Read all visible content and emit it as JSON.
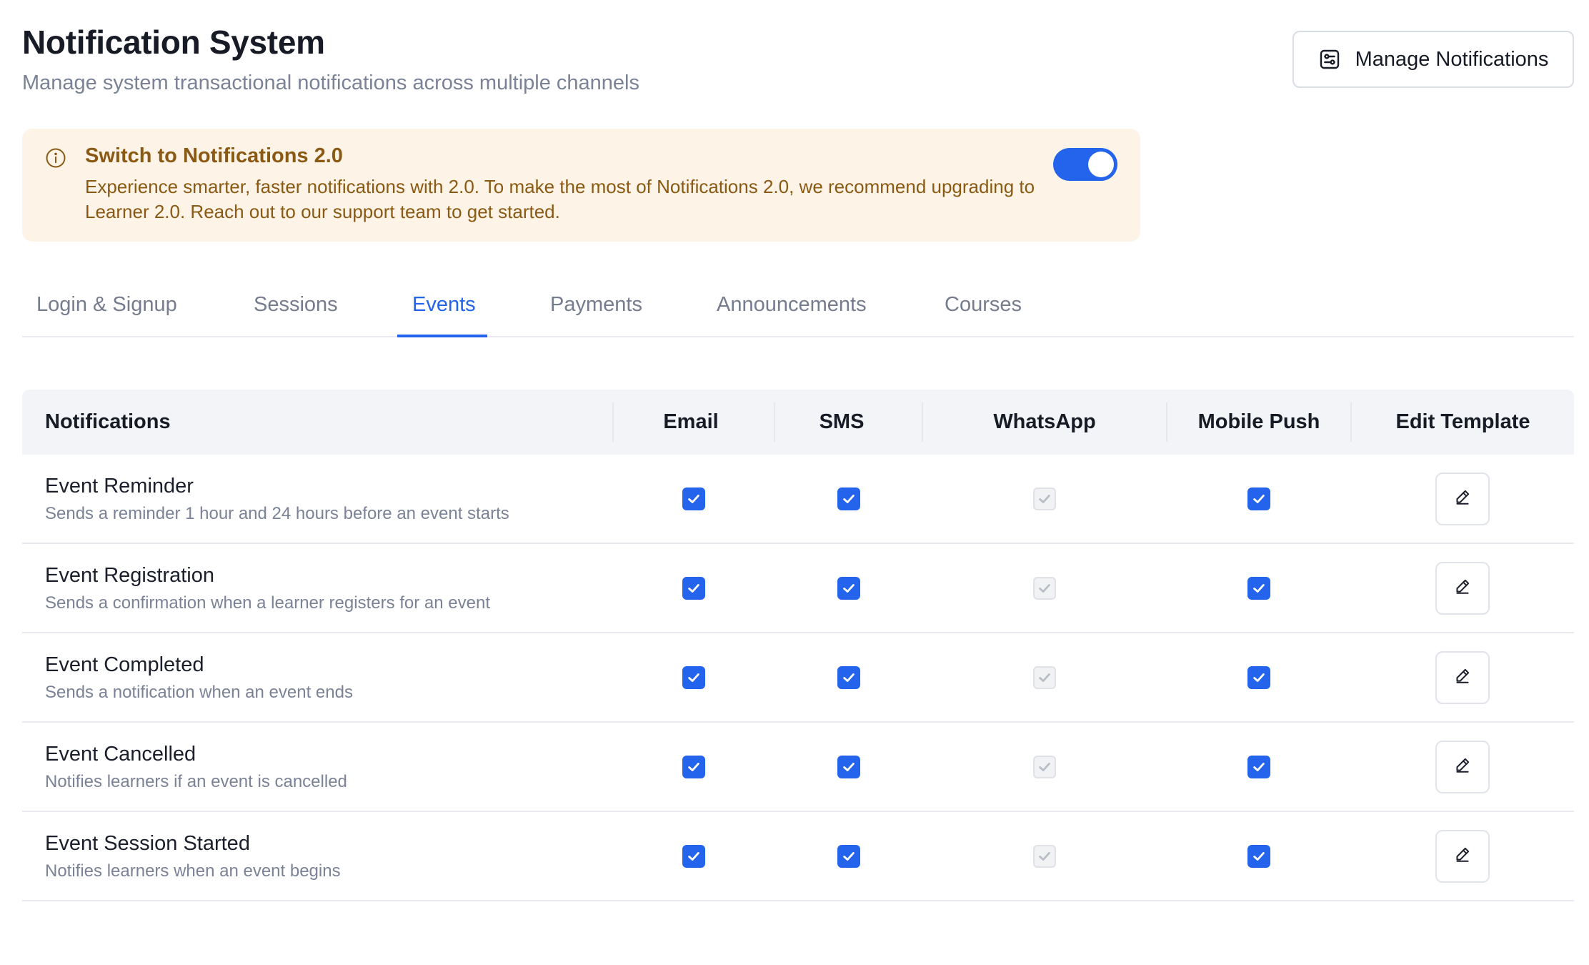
{
  "header": {
    "title": "Notification System",
    "subtitle": "Manage system transactional notifications across multiple channels",
    "manage_button_label": "Manage Notifications",
    "manage_button_icon": "settings-sliders-icon"
  },
  "banner": {
    "icon": "info-icon",
    "title": "Switch to Notifications 2.0",
    "text": "Experience smarter, faster notifications with 2.0. To make the most of Notifications 2.0, we recommend upgrading to Learner 2.0. Reach out to our support team to get started.",
    "toggle_on": true,
    "background_color": "#fdf3e7",
    "text_color": "#8a5a14"
  },
  "tabs": [
    {
      "label": "Login & Signup",
      "active": false
    },
    {
      "label": "Sessions",
      "active": false
    },
    {
      "label": "Events",
      "active": true
    },
    {
      "label": "Payments",
      "active": false
    },
    {
      "label": "Announcements",
      "active": false
    },
    {
      "label": "Courses",
      "active": false
    }
  ],
  "table": {
    "columns": [
      "Notifications",
      "Email",
      "SMS",
      "WhatsApp",
      "Mobile Push",
      "Edit Template"
    ],
    "rows": [
      {
        "name": "Event Reminder",
        "description": "Sends a reminder 1 hour and 24 hours before an event starts",
        "email": true,
        "sms": true,
        "whatsapp": "disabled-checked",
        "mobile_push": true
      },
      {
        "name": "Event Registration",
        "description": "Sends a confirmation when a learner registers for an event",
        "email": true,
        "sms": true,
        "whatsapp": "disabled-checked",
        "mobile_push": true
      },
      {
        "name": "Event Completed",
        "description": "Sends a notification when an event ends",
        "email": true,
        "sms": true,
        "whatsapp": "disabled-checked",
        "mobile_push": true
      },
      {
        "name": "Event Cancelled",
        "description": "Notifies learners if an event is cancelled",
        "email": true,
        "sms": true,
        "whatsapp": "disabled-checked",
        "mobile_push": true
      },
      {
        "name": "Event Session Started",
        "description": "Notifies learners when an event begins",
        "email": true,
        "sms": true,
        "whatsapp": "disabled-checked",
        "mobile_push": true
      }
    ],
    "edit_icon": "pencil-icon"
  },
  "colors": {
    "accent": "#2463eb",
    "muted_text": "#7a8296",
    "header_bg": "#f3f4f7"
  }
}
